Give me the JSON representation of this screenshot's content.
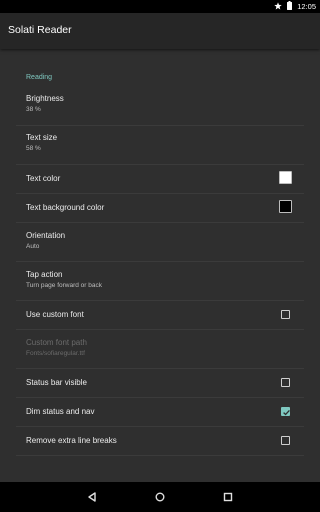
{
  "status_bar": {
    "time": "12:05",
    "icons": [
      "star-icon",
      "battery-icon"
    ]
  },
  "app_bar": {
    "title": "Solati Reader"
  },
  "section": {
    "header": "Reading"
  },
  "prefs": {
    "brightness": {
      "title": "Brightness",
      "summary": "38 %"
    },
    "text_size": {
      "title": "Text size",
      "summary": "58 %"
    },
    "text_color": {
      "title": "Text color",
      "swatch": "#ffffff"
    },
    "text_bg_color": {
      "title": "Text background color",
      "swatch": "#000000"
    },
    "orientation": {
      "title": "Orientation",
      "summary": "Auto"
    },
    "tap_action": {
      "title": "Tap action",
      "summary": "Turn page forward or back"
    },
    "use_custom_font": {
      "title": "Use custom font",
      "checked": false
    },
    "custom_font_path": {
      "title": "Custom font path",
      "summary": "Fonts/sofiaregular.ttf",
      "enabled": false
    },
    "status_bar_visible": {
      "title": "Status bar visible",
      "checked": false
    },
    "dim_status_nav": {
      "title": "Dim status and nav",
      "checked": true
    },
    "remove_line_breaks": {
      "title": "Remove extra line breaks",
      "checked": false
    }
  },
  "colors": {
    "accent": "#7fc8c0",
    "background": "#2f2f2f",
    "app_bar": "#262626"
  },
  "nav_bar": {
    "icons": [
      "back-icon",
      "home-icon",
      "recents-icon"
    ]
  }
}
